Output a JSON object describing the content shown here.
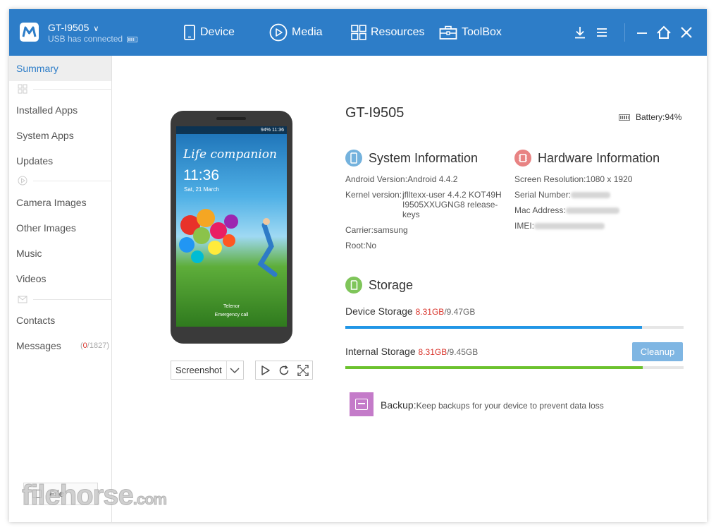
{
  "header": {
    "device_name": "GT-I9505",
    "connection": "USB has connected",
    "nav": [
      {
        "label": "Device",
        "icon": "phone-icon"
      },
      {
        "label": "Media",
        "icon": "play-circle-icon"
      },
      {
        "label": "Resources",
        "icon": "grid-icon"
      },
      {
        "label": "ToolBox",
        "icon": "toolbox-icon"
      }
    ]
  },
  "sidebar": {
    "summary": "Summary",
    "installed_apps": "Installed Apps",
    "system_apps": "System Apps",
    "updates": "Updates",
    "camera_images": "Camera Images",
    "other_images": "Other Images",
    "music": "Music",
    "videos": "Videos",
    "contacts": "Contacts",
    "messages": "Messages",
    "messages_unread": "0",
    "messages_total": "/1827",
    "file_button": "File"
  },
  "phone_screen": {
    "tagline": "Life companion",
    "time": "11:36",
    "date": "Sat, 21 March",
    "status": "94% 11:36",
    "carrier": "Telenor",
    "emergency": "Emergency call"
  },
  "screenshot": {
    "label": "Screenshot"
  },
  "device": {
    "model": "GT-I9505",
    "battery": "Battery:94%"
  },
  "system_info": {
    "title": "System Information",
    "android_label": "Android Version:",
    "android_value": "Android 4.4.2",
    "kernel_label": "Kernel version:",
    "kernel_value_1": "jflltexx-user 4.4.2 KOT49H",
    "kernel_value_2": "I9505XXUGNG8 release-",
    "kernel_value_3": "keys",
    "carrier_label": "Carrier:",
    "carrier_value": "samsung",
    "root_label": "Root:",
    "root_value": "No"
  },
  "hardware_info": {
    "title": "Hardware Information",
    "resolution_label": "Screen Resolution:",
    "resolution_value": "1080 x 1920",
    "serial_label": "Serial Number:",
    "mac_label": "Mac Address:",
    "imei_label": "IMEI:"
  },
  "storage": {
    "title": "Storage",
    "device_label": "Device Storage",
    "device_used": "8.31GB",
    "device_total": "/9.47GB",
    "device_fraction": 0.877,
    "internal_label": "Internal Storage",
    "internal_used": "8.31GB",
    "internal_total": "/9.45GB",
    "internal_fraction": 0.879,
    "cleanup": "Cleanup"
  },
  "backup": {
    "label": "Backup:",
    "description": "Keep backups for your device to prevent data loss"
  },
  "colors": {
    "accent": "#2d7dc8",
    "device_bar": "#2196e6",
    "internal_bar": "#6cc22e",
    "used_red": "#d9342b"
  }
}
